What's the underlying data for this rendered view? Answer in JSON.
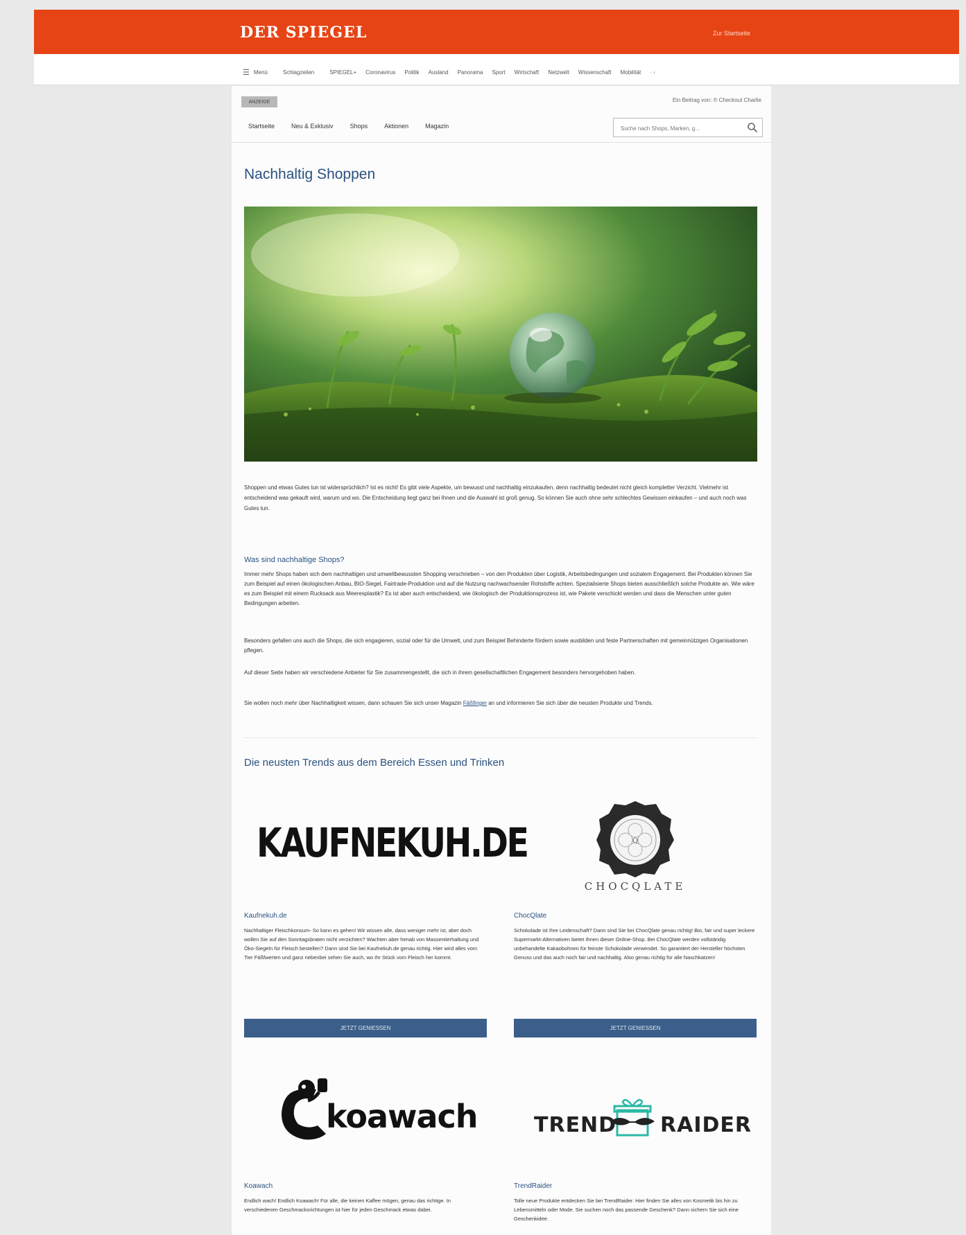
{
  "header": {
    "brand": "DER SPIEGEL",
    "to_start": "Zur Startseite",
    "color": "#e64415"
  },
  "nav": {
    "menu_label": "Menü",
    "items": [
      "Schlagzeilen",
      "SPIEGEL+",
      "Coronavirus",
      "Politik",
      "Ausland",
      "Panorama",
      "Sport",
      "Wirtschaft",
      "Netzwelt",
      "Wissenschaft",
      "Mobilität"
    ],
    "more": "· ›"
  },
  "partner": {
    "ad_label": "ANZEIGE",
    "contribution": "Ein Beitrag von: ℗ Checkout Charlie",
    "subnav": [
      "Startseite",
      "Neu & Exklusiv",
      "Shops",
      "Aktionen",
      "Magazin"
    ],
    "search_placeholder": "Suche nach Shops, Marken, g..."
  },
  "page": {
    "title": "Nachhaltig Shoppen",
    "intro": "Shoppen und etwas Gutes tun ist widersprüchlich? Ist es nicht! Es gibt viele Aspekte, um bewusst und nachhaltig einzukaufen, denn nachhaltig bedeutet nicht gleich kompletter Verzicht. Vielmehr ist entscheidend was gekauft wird, warum und wo. Die Entscheidung liegt ganz bei Ihnen und die Auswahl ist groß genug. So können Sie auch ohne sehr schlechtes Gewissen einkaufen – und auch noch was Gutes tun.",
    "section_title": "Was sind nachhaltige Shops?",
    "para1": "Immer mehr Shops haben sich dem nachhaltigen und umweltbewussten Shopping verschrieben – von den Produkten über Logistik, Arbeitsbedingungen und sozialem Engagement. Bei Produkten können Sie zum Beispiel auf einen ökologischen Anbau, BIO-Siegel, Fairtrade-Produktion und auf die Nutzung nachwachsender Rohstoffe achten. Spezialisierte Shops bieten ausschließlich solche Produkte an. Wie wäre es zum Beispiel mit einem Rucksack aus Meeresplastik? Es ist aber auch entscheidend, wie ökologisch der Produktionsprozess ist, wie Pakete verschickt werden und dass die Menschen unter guten Bedingungen arbeiten.",
    "para2": "Besonders gefallen uns auch die Shops, die sich engagieren, sozial oder für die Umwelt, und zum Beispiel Behinderte fördern sowie ausbilden und feste Partnerschaften mit gemeinnützigen Organisationen pflegen.",
    "para3": "Auf dieser Seite haben wir verschiedene Anbieter für Sie zusammengestellt, die sich in ihrem gesellschaftlichen Engagement besonders hervorgehoben haben.",
    "para4_before": "Sie wollen noch mehr über Nachhaltigkeit wissen, dann schauen Sie sich unser Magazin ",
    "para4_link": "Fäßfinger",
    "para4_after": " an und informieren Sie sich über die neusten Produkte und Trends.",
    "trends_title": "Die neusten Trends aus dem Bereich Essen und Trinken"
  },
  "shops": [
    {
      "logo_text": "KAUFNEKUH.DE",
      "name": "Kaufnekuh.de",
      "text": "Nachhaltiger Fleischkonsum- So kann es gehen! Wir wissen alle, dass weniger mehr ist, aber doch wollen Sie auf den Sonntagsbraten nicht verzichten? Wachten aber henab von Massentierhaltung und Öko-Siegeln für Fleisch bestellen? Dann sind Sie bei Kaufnekuh.de genau richtig. Hier wird alles vom Tier Fäßfwerten und ganz nebenbei sehen Sie auch, wo Ihr Stück vom Fleisch her kommt.",
      "cta": "JETZT GENIESSEN"
    },
    {
      "logo_text": "CHOCQLATE",
      "name": "ChocQlate",
      "text": "Schokolade ist Ihre Leidenschaft? Dann sind Sie bei ChocQlate genau richtig! Bio, fair und super leckere Supermarkt-Alternativen bietet Ihnen dieser Online-Shop. Bei ChocQlate werden vollständig unbehandelte Kakaobohnen für feinste Schokolade verwendet. So garantiert der Hersteller höchsten Genuss und das auch noch fair und nachhaltig. Also genau richtig für alle Naschkatzen!",
      "cta": "JETZT GENIESSEN"
    },
    {
      "logo_text": "koawach",
      "name": "Koawach",
      "text": "Endlich wach! Endlich Koawach! Für alle, die keinen Kaffee mögen, genau das richtige. In verschiedenen Geschmacksrichtungen ist hier für jeden Geschmack etwas dabei."
    },
    {
      "logo_text_left": "TREND",
      "logo_text_right": "RAIDER",
      "name": "TrendRaider",
      "text": "Tolle neue Produkte entdecken Sie bei TrendRaider. Hier finden Sie alles von Kosmetik bis hin zu Lebensmitteln oder Mode. Sie suchen noch das passende Geschenk? Dann sichern Sie sich eine Geschenkidee."
    }
  ],
  "colors": {
    "accent": "#2a5180",
    "button": "#3b5f8a",
    "trendraider_teal": "#2bb8a6"
  }
}
